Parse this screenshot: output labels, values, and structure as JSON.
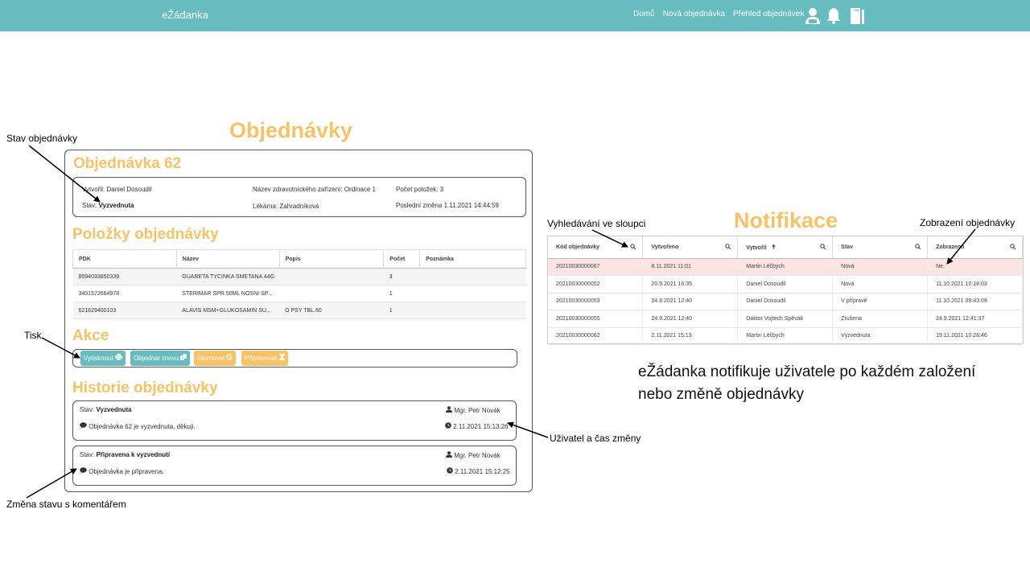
{
  "navbar": {
    "brand": "eŽádanka",
    "links": [
      "Domů",
      "Nová objednávka",
      "Přehled objednávek"
    ],
    "icons": [
      "user-badge-icon",
      "bell-icon",
      "logout-door-icon"
    ],
    "color": "#66bcbe"
  },
  "annotations": {
    "status": "Stav objednávky",
    "print": "Tisk",
    "status_change": "Změna stavu s komentářem",
    "user_time": "Uživatel a čas změny",
    "column_search": "Vyhledávání ve sloupci",
    "order_display": "Zobrazení objednávky"
  },
  "orders": {
    "title": "Objednávky",
    "order_title": "Objednávka",
    "order_number": "62",
    "info": {
      "created_by": "Vytvořil: Daniel Dosoudil",
      "status_label": "Stav:",
      "status_value": "Vyzvednuta",
      "facility": "Název zdravotnického zařízení: Ordinace 1",
      "pharmacy": "Lékárna: Zahradníková",
      "item_count": "Počet položek: 3",
      "last_change": "Poslední změna  1.11.2021 14:44:59"
    },
    "items_title": "Položky objednávky",
    "items_columns": [
      "PDK",
      "Název",
      "Popis",
      "Počet",
      "Poznámka"
    ],
    "items": [
      {
        "pdk": "8594033650339",
        "name": "GUARETA TYCINKA SMETANA 44G",
        "desc": "",
        "count": "3",
        "note": ""
      },
      {
        "pdk": "3401572664978",
        "name": "STERIMAR SPR.50ML NOSNI SP...",
        "desc": "",
        "count": "1",
        "note": ""
      },
      {
        "pdk": "621629400103",
        "name": "ALAVIS MSM+GLUKOSAMIN SU...",
        "desc": "O PSY TBL.60",
        "count": "1",
        "note": ""
      }
    ],
    "actions_title": "Akce",
    "actions": {
      "print": "Vytisknout",
      "reorder": "Objednat znovu",
      "cancel": "Stornovat",
      "prepare": "Připravovat"
    },
    "accent_teal": "#66bcbe",
    "accent_orange": "#f9c264",
    "history_title": "Historie objednávky",
    "history": [
      {
        "status_label": "Stav:",
        "status": "Vyzvednuta",
        "user": "Mgr. Petr Novák",
        "comment": "Objednávka 62 je vyzvednuta, děkuji.",
        "time": "2.11.2021 15:13:26"
      },
      {
        "status_label": "Stav:",
        "status": "Připravena k vyzvednutí",
        "user": "Mgr. Petr Novák",
        "comment": "Objednávka je připravena.",
        "time": "2.11.2021 15:12:25"
      }
    ]
  },
  "notifications": {
    "title": "Notifikace",
    "columns": [
      "Kód objednávky",
      "Vytvořeno",
      "Vytvořil",
      "Stav",
      "Zobrazeno"
    ],
    "sorted_column": "Vytvořil",
    "rows": [
      {
        "code": "20210030000067",
        "created": "8.11.2021 11:01",
        "by": "Martin Léčbych",
        "status": "Nová",
        "shown": "Ne",
        "highlight": true
      },
      {
        "code": "20210030000052",
        "created": "20.9.2021 16:35",
        "by": "Daniel Dosoudil",
        "status": "Nová",
        "shown": "11.10.2021 10:18:03",
        "highlight": false
      },
      {
        "code": "20210030000053",
        "created": "24.9.2021 12:40",
        "by": "Daniel Dosoudil",
        "status": "V přípravě",
        "shown": "11.10.2021 09:43:09",
        "highlight": false
      },
      {
        "code": "20210030000055",
        "created": "24.9.2021 12:40",
        "by": "Doktor Vojtech Spěvák",
        "status": "Zrušena",
        "shown": "24.9.2021 12:41:37",
        "highlight": false
      },
      {
        "code": "20210030000062",
        "created": "2.11.2021 15:13",
        "by": "Martin Léčbych",
        "status": "Vyzvednuta",
        "shown": "19.11.2021 10:28:46",
        "highlight": false
      }
    ],
    "highlight_color": "#fbe4e2"
  },
  "description": "eŽádanka notifikuje uživatele po každém založení nebo změně objednávky"
}
